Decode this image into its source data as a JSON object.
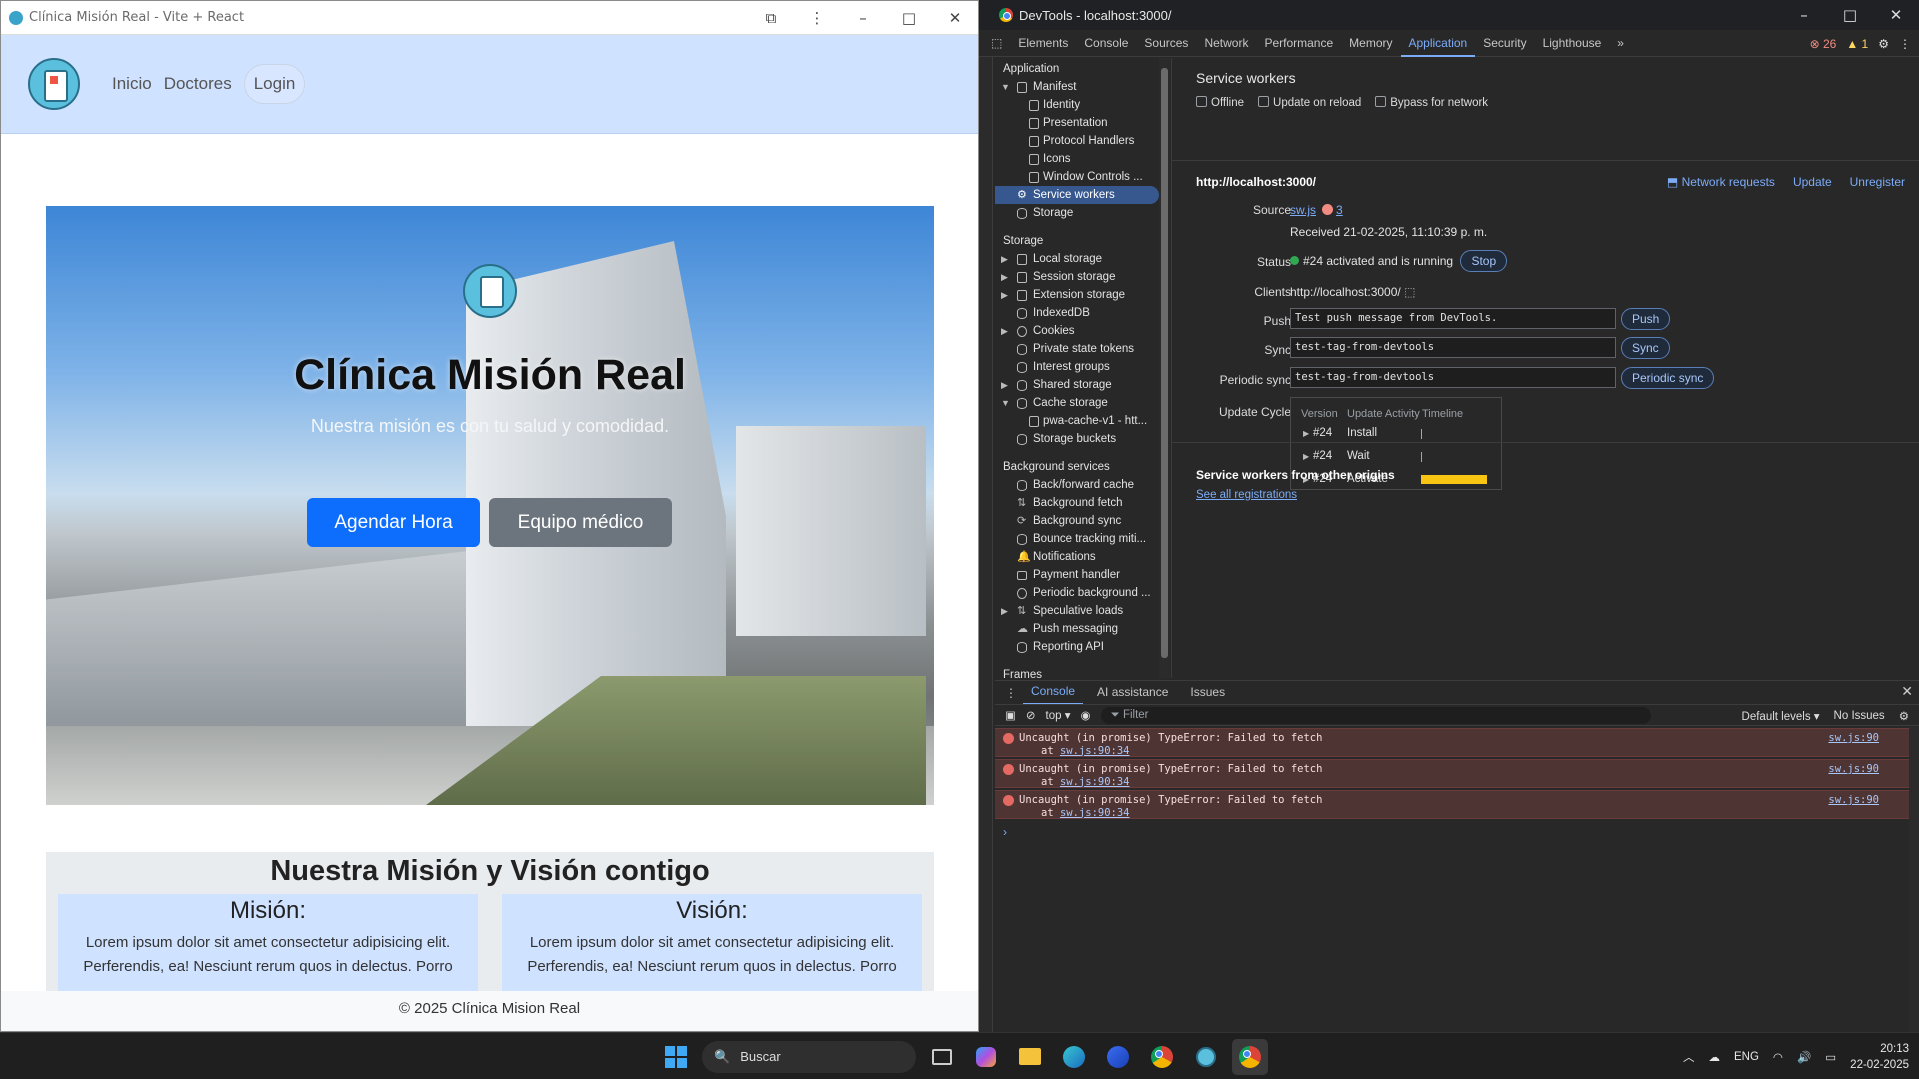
{
  "browser": {
    "title": "Clínica Misión Real - Vite + React",
    "nav": {
      "links": [
        "Inicio",
        "Doctores"
      ],
      "login": "Login"
    },
    "hero": {
      "title": "Clínica Misión Real",
      "subtitle": "Nuestra misión es con tu salud y comodidad.",
      "primary_button": "Agendar Hora",
      "secondary_button": "Equipo médico"
    },
    "mission_vision": {
      "title": "Nuestra Misión y Visión contigo",
      "mision_title": "Misión:",
      "vision_title": "Visión:",
      "text_line1": "Lorem ipsum dolor sit amet consectetur adipisicing elit.",
      "text_line2": "Perferendis, ea! Nesciunt rerum quos in delectus. Porro"
    },
    "footer": "© 2025 Clínica Mision Real"
  },
  "devtools": {
    "title": "DevTools - localhost:3000/",
    "tabs": [
      "Elements",
      "Console",
      "Sources",
      "Network",
      "Performance",
      "Memory",
      "Application",
      "Security",
      "Lighthouse"
    ],
    "active_tab": "Application",
    "error_count": "26",
    "warning_count": "1",
    "sidebar": {
      "application_header": "Application",
      "application_items": [
        "Manifest",
        "Identity",
        "Presentation",
        "Protocol Handlers",
        "Icons",
        "Window Controls ...",
        "Service workers",
        "Storage"
      ],
      "storage_header": "Storage",
      "storage_items": [
        "Local storage",
        "Session storage",
        "Extension storage",
        "IndexedDB",
        "Cookies",
        "Private state tokens",
        "Interest groups",
        "Shared storage",
        "Cache storage",
        "pwa-cache-v1 - htt...",
        "Storage buckets"
      ],
      "background_header": "Background services",
      "background_items": [
        "Back/forward cache",
        "Background fetch",
        "Background sync",
        "Bounce tracking miti...",
        "Notifications",
        "Payment handler",
        "Periodic background ...",
        "Speculative loads",
        "Push messaging",
        "Reporting API"
      ],
      "frames_header": "Frames"
    },
    "service_workers": {
      "heading": "Service workers",
      "options": [
        "Offline",
        "Update on reload",
        "Bypass for network"
      ],
      "origin": "http://localhost:3000/",
      "actions": [
        "Network requests",
        "Update",
        "Unregister"
      ],
      "source_label": "Source",
      "source_file": "sw.js",
      "source_errors": "3",
      "received": "Received 21-02-2025, 11:10:39 p. m.",
      "status_label": "Status",
      "status_text": "#24 activated and is running",
      "stop_button": "Stop",
      "clients_label": "Clients",
      "clients_value": "http://localhost:3000/",
      "push_label": "Push",
      "push_value": "Test push message from DevTools.",
      "push_button": "Push",
      "sync_label": "Sync",
      "sync_value": "test-tag-from-devtools",
      "sync_button": "Sync",
      "periodic_label": "Periodic sync",
      "periodic_value": "test-tag-from-devtools",
      "periodic_button": "Periodic sync",
      "update_cycle_label": "Update Cycle",
      "update_cycle_headers": [
        "Version",
        "Update Activity",
        "Timeline"
      ],
      "update_cycle_rows": [
        {
          "version": "#24",
          "activity": "Install"
        },
        {
          "version": "#24",
          "activity": "Wait"
        },
        {
          "version": "#24",
          "activity": "Activate"
        }
      ],
      "other_origins_heading": "Service workers from other origins",
      "see_all": "See all registrations"
    },
    "drawer": {
      "tabs": [
        "Console",
        "AI assistance",
        "Issues"
      ],
      "context": "top",
      "filter_placeholder": "Filter",
      "levels": "Default levels",
      "issues": "No Issues",
      "messages": [
        {
          "text": "Uncaught (in promise) TypeError: Failed to fetch",
          "at_prefix": "at ",
          "at_link": "sw.js:90:34",
          "source": "sw.js:90"
        },
        {
          "text": "Uncaught (in promise) TypeError: Failed to fetch",
          "at_prefix": "at ",
          "at_link": "sw.js:90:34",
          "source": "sw.js:90"
        },
        {
          "text": "Uncaught (in promise) TypeError: Failed to fetch",
          "at_prefix": "at ",
          "at_link": "sw.js:90:34",
          "source": "sw.js:90"
        }
      ]
    }
  },
  "taskbar": {
    "search": "Buscar",
    "language": "ENG",
    "time": "20:13",
    "date": "22-02-2025"
  },
  "colors": {
    "primary_button": "#0d6efd",
    "secondary_button": "#6c757d",
    "nav_bg": "#cfe2ff",
    "devtools_accent": "#7cacf8"
  }
}
